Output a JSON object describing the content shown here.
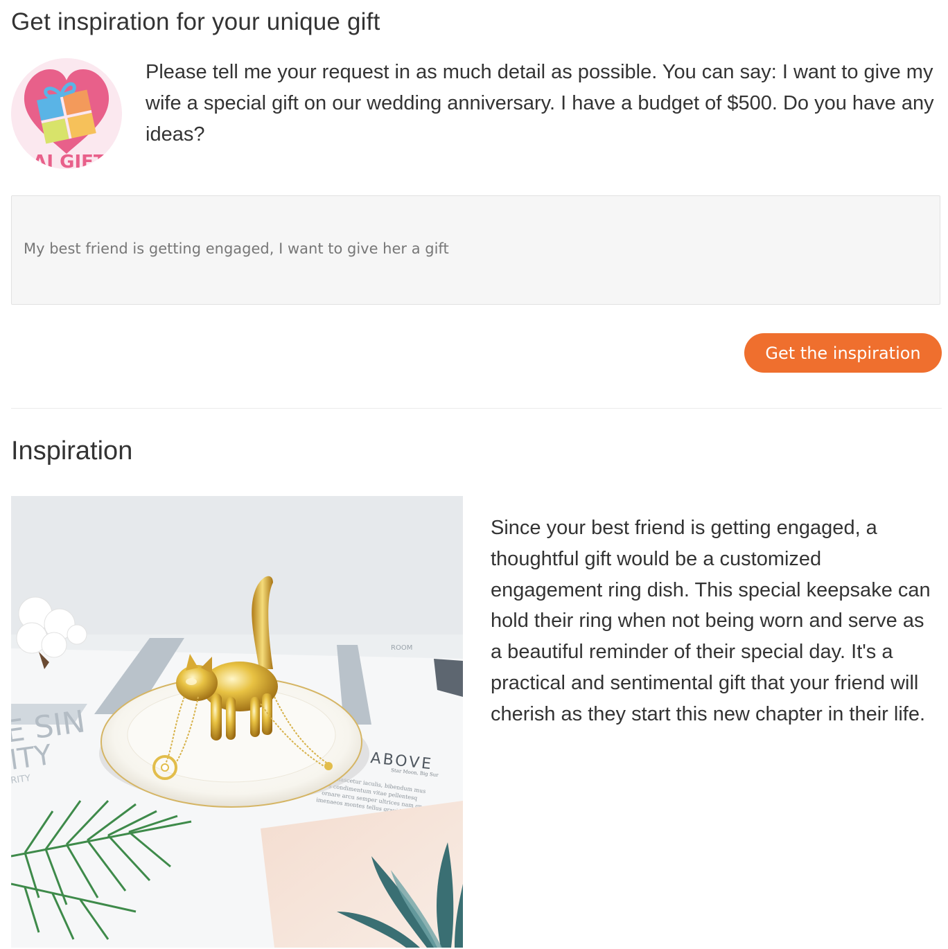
{
  "page": {
    "title": "Get inspiration for your unique gift"
  },
  "intro": {
    "logo_icon": "ai-gift-logo-icon",
    "logo_text": "AI GIFT",
    "message": "Please tell me your request in as much detail as possible. You can say: I want to give my wife a special gift on our wedding anniversary. I have a budget of $500. Do you have any ideas?"
  },
  "request_input": {
    "value": "My best friend is getting engaged, I want to give her a gift"
  },
  "actions": {
    "submit_label": "Get the inspiration"
  },
  "inspiration": {
    "heading": "Inspiration",
    "image_icon": "ring-dish-photo",
    "image_print": {
      "headline_letters": "E SIN",
      "subline_letters": "ITY",
      "small_letters": "RITY",
      "above_text": "ABOVE",
      "tiny_caption": "Star Moon, Big Sur",
      "body_lines": [
        "nascetur iaculis, bibendum mus",
        "s condimentum vitae pellentesq",
        "ornare arcu semper ultrices nam gr",
        "imenaeos montes tellus gravida port"
      ],
      "top_right_letters": "ROOM"
    },
    "answer": "Since your best friend is getting engaged, a thoughtful gift would be a customized engagement ring dish. This special keepsake can hold their ring when not being worn and serve as a beautiful reminder of their special day. It's a practical and sentimental gift that your friend will cherish as they start this new chapter in their life."
  },
  "colors": {
    "accent": "#ef6f2e",
    "logo_heart": "#e8608a",
    "logo_background": "#fbe8ef",
    "input_background": "#f6f6f6",
    "text": "#333333"
  }
}
